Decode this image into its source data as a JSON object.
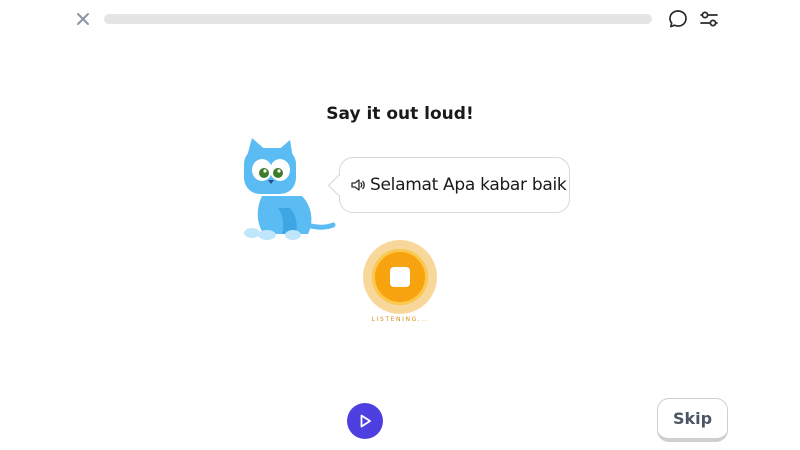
{
  "top_bar": {
    "close_icon": "close-icon",
    "progress": 0,
    "chat_icon": "chat-bubble-icon",
    "settings_icon": "sliders-icon"
  },
  "prompt": {
    "title": "Say it out loud!"
  },
  "bubble": {
    "speaker_icon": "speaker-icon",
    "phrase": "Selamat Apa kabar baik"
  },
  "record": {
    "state": "stop",
    "status_label": "LISTENING..."
  },
  "bottom": {
    "play_icon": "play-icon",
    "skip_label": "Skip"
  },
  "colors": {
    "accent": "#f7a20f",
    "play": "#4e3fe0",
    "character": "#5bbcf4"
  }
}
